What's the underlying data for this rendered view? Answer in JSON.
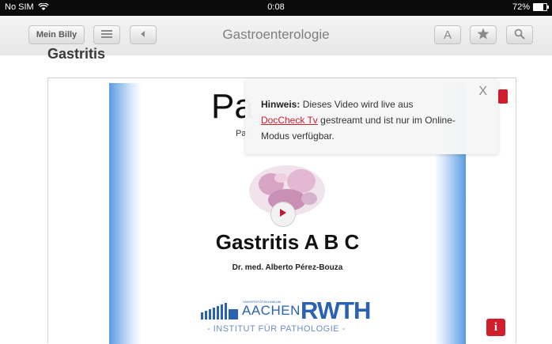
{
  "status": {
    "carrier": "No SIM",
    "time": "0:08",
    "battery": "72%",
    "battery_level": 0.72
  },
  "navbar": {
    "home_label": "Mein Billy",
    "title": "Gastroenterologie",
    "font_label": "A",
    "icons": {
      "list": "list-icon",
      "back": "back-icon",
      "bookmark": "star-icon",
      "search": "search-icon"
    }
  },
  "page": {
    "heading": "Gastritis"
  },
  "slide": {
    "big_text": "Pa",
    "sub_text": "Pat",
    "title": "Gastritis A B C",
    "author": "Dr. med. Alberto Pérez-Bouza",
    "logo_uni": "UNIVERSITÄTSKLINIKUM",
    "logo_city": "AACHEN",
    "logo_brand": "RWTH",
    "institute": "- INSTITUT FÜR PATHOLOGIE -"
  },
  "popup": {
    "label": "Hinweis:",
    "text_before": "Dieses Video wird live aus",
    "link": "DocCheck Tv",
    "text_after": "gestreamt und ist nur im Online-Modus verfügbar.",
    "close": "X"
  },
  "info_button": "i",
  "colors": {
    "accent": "#d01e2d",
    "brand_blue": "#2a62b2"
  }
}
